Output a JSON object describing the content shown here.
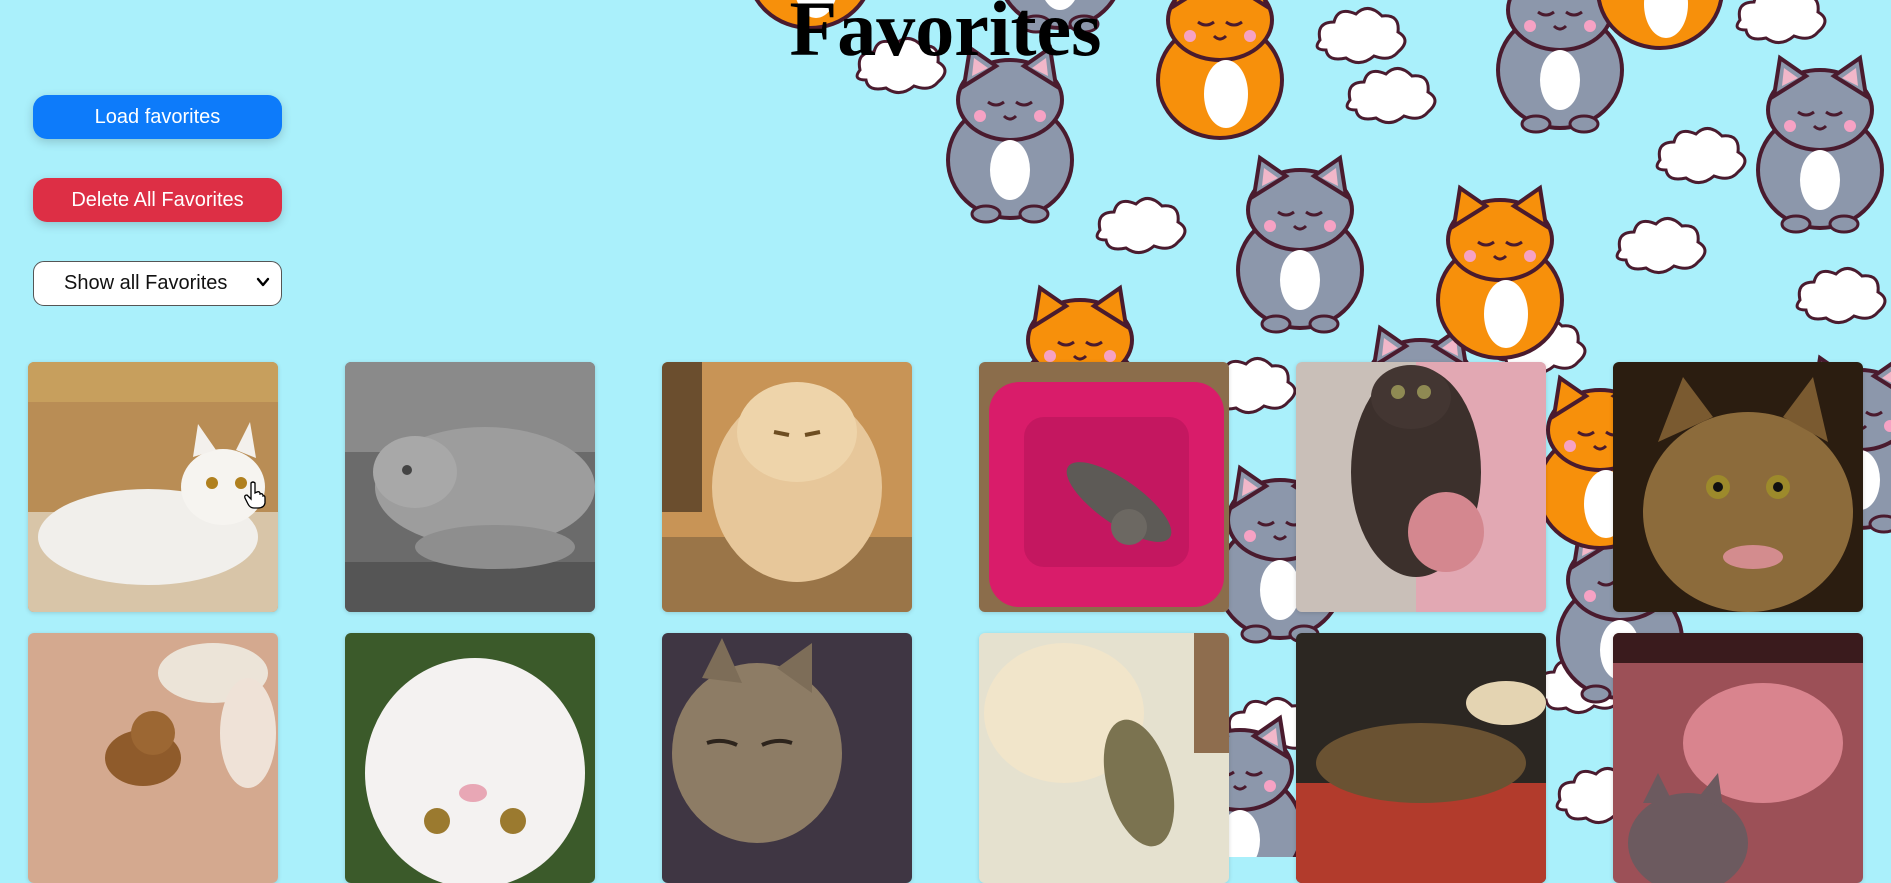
{
  "page": {
    "title": "Favorites"
  },
  "controls": {
    "load_label": "Load favorites",
    "delete_label": "Delete All Favorites",
    "filter": {
      "selected": "Show all Favorites"
    }
  },
  "favorites": [
    {
      "name": "white-cat-lying",
      "icon": "white cat lounging on floor"
    },
    {
      "name": "grey-cat-bw",
      "icon": "black and white photo of cat lying down"
    },
    {
      "name": "fluffy-orange-cat",
      "icon": "fluffy ginger cat standing"
    },
    {
      "name": "kitten-pink-bed",
      "icon": "tabby kitten in pink bed"
    },
    {
      "name": "cat-held-up",
      "icon": "dark cat being held"
    },
    {
      "name": "tabby-bow",
      "icon": "tabby cat with bow"
    },
    {
      "name": "cat-on-bed",
      "icon": "cat on quilted bed"
    },
    {
      "name": "white-cat-upside-down",
      "icon": "white cat upside down"
    },
    {
      "name": "sleeping-kitten",
      "icon": "sleeping tabby kitten"
    },
    {
      "name": "two-cats-floor",
      "icon": "two cats lying on floor"
    },
    {
      "name": "cat-on-pillow",
      "icon": "cat sleeping on pillow"
    },
    {
      "name": "cat-pink-light",
      "icon": "cat in pink light"
    }
  ]
}
